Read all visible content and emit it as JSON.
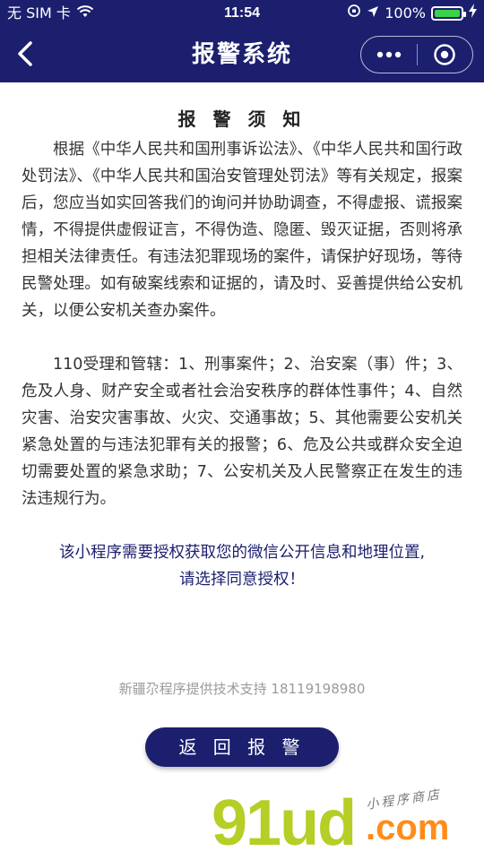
{
  "status_bar": {
    "carrier": "无 SIM 卡",
    "time": "11:54",
    "battery_percent_label": "100%",
    "battery_level": 1.0
  },
  "nav": {
    "title": "报警系统",
    "back_icon": "chevron-left-icon",
    "more_icon": "more-dots-icon",
    "close_icon": "target-circle-icon"
  },
  "notice": {
    "title": "报 警 须 知",
    "paragraph1": "根据《中华人民共和国刑事诉讼法》、《中华人民共和国行政处罚法》、《中华人民共和国治安管理处罚法》等有关规定，报案后，您应当如实回答我们的询问并协助调查，不得虚报、谎报案情，不得提供虚假证言，不得伪造、隐匿、毁灭证据，否则将承担相关法律责任。有违法犯罪现场的案件，请保护好现场，等待民警处理。如有破案线索和证据的，请及时、妥善提供给公安机关，以便公安机关查办案件。",
    "paragraph2": "110受理和管辖：1、刑事案件；2、治安案（事）件；3、危及人身、财产安全或者社会治安秩序的群体性事件；4、自然灾害、治安灾害事故、火灾、交通事故；5、其他需要公安机关紧急处置的与违法犯罪有关的报警；6、危及公共或群众安全迫切需要处置的紧急求助；7、公安机关及人民警察正在发生的违法违规行为。"
  },
  "authorization": {
    "line1": "该小程序需要授权获取您的微信公开信息和地理位置,",
    "line2": "请选择同意授权！"
  },
  "footer": {
    "support": "新疆尕程序提供技术支持 18119198980",
    "return_button": "返 回 报 警"
  },
  "watermark": {
    "logo": "91ud",
    "domain": ".com",
    "tagline": "小程序商店"
  },
  "colors": {
    "header_bg": "#1b1f6e",
    "button_bg": "#1b1f6e",
    "auth_text": "#1b1f6e",
    "battery": "#3ad34a"
  }
}
